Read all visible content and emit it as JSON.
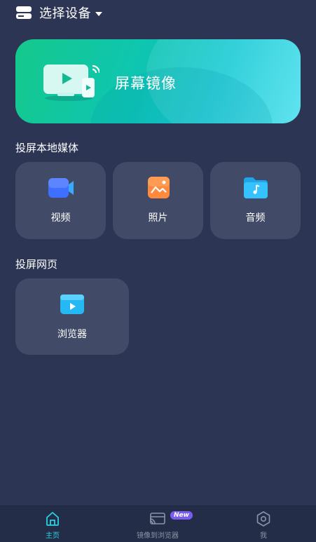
{
  "header": {
    "title": "选择设备"
  },
  "banner": {
    "label": "屏幕镜像"
  },
  "sections": {
    "local_media": "投屏本地媒体",
    "web": "投屏网页"
  },
  "media_cards": {
    "video": "视频",
    "photo": "照片",
    "audio": "音频"
  },
  "web_cards": {
    "browser": "浏览器"
  },
  "tabs": {
    "home": "主页",
    "mirror_browser": "镜像到浏览器",
    "me": "我",
    "new_badge": "New"
  },
  "colors": {
    "background": "#2c3654",
    "card": "#414a66",
    "accent": "#27d3e4",
    "banner_start": "#15c98b",
    "banner_end": "#4ee1ee",
    "badge": "#7b5cf0"
  }
}
